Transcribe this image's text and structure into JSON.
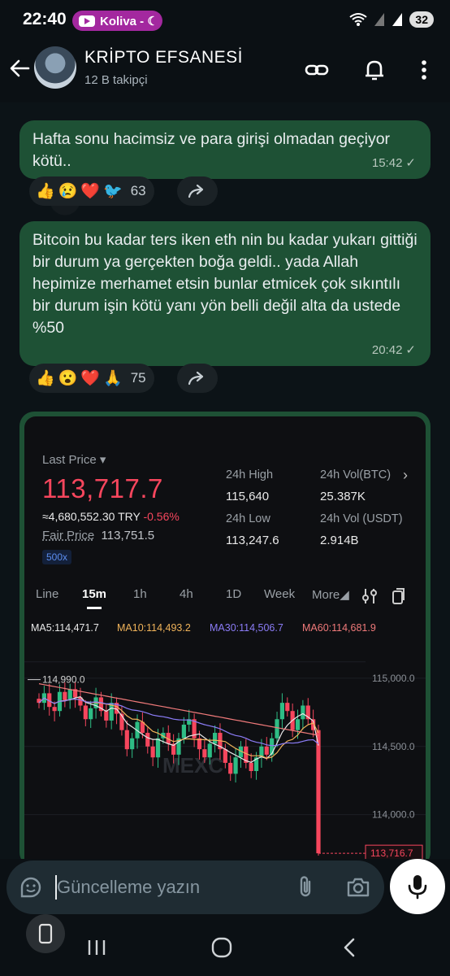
{
  "status_bar": {
    "time": "22:40",
    "media_app": "Koliva - ☾",
    "battery": "32"
  },
  "header": {
    "title": "KRİPTO EFSANESİ",
    "subtitle": "12 B takipçi"
  },
  "messages": [
    {
      "text": "Hafta sonu hacimsiz ve para girişi olmadan geçiyor kötü..",
      "time": "15:42",
      "reactions": [
        "👍",
        "😢",
        "❤️",
        "🐦"
      ],
      "reaction_count": "63"
    },
    {
      "text": "Bitcoin bu kadar ters iken eth nin bu kadar yukarı gittiği bir durum ya gerçekten boğa geldi.. yada Allah hepimize merhamet etsin bunlar etmicek  çok sıkıntılı bir durum işin kötü yanı yön belli değil alta da ustede %50",
      "time": "20:42",
      "reactions": [
        "👍",
        "😮",
        "❤️",
        "🙏"
      ],
      "reaction_count": "75"
    }
  ],
  "trading_screenshot": {
    "last_price_label": "Last Price",
    "last_price": "113,717.7",
    "try_price": "≈4,680,552.30 TRY",
    "change": "-0.56%",
    "fair_price_label": "Fair Price",
    "fair_price": "113,751.5",
    "leverage": "500x",
    "stats": [
      {
        "label": "24h High",
        "value": "115,640"
      },
      {
        "label": "24h Vol(BTC)",
        "value": "25.387K"
      },
      {
        "label": "24h Low",
        "value": "113,247.6"
      },
      {
        "label": "24h Vol (USDT)",
        "value": "2.914B"
      }
    ],
    "tabs": [
      "Line",
      "15m",
      "1h",
      "4h",
      "1D",
      "Week",
      "More"
    ],
    "active_tab": "15m",
    "ma": [
      {
        "label": "MA5:114,471.7",
        "color": "#e8e8e8"
      },
      {
        "label": "MA10:114,493.2",
        "color": "#f0b35a"
      },
      {
        "label": "MA30:114,506.7",
        "color": "#8b7cf6"
      },
      {
        "label": "MA60:114,681.9",
        "color": "#f07a7a"
      }
    ],
    "watermark": "MEXC"
  },
  "chart_data": {
    "type": "candlestick",
    "y_ticks": [
      "115,000.0",
      "114,500.0",
      "114,000.0"
    ],
    "ylim": [
      113700,
      115250
    ],
    "high_marker": "114,990.0",
    "current_price_tag": "113,716.7",
    "candles_close": [
      114820,
      114890,
      114790,
      114760,
      114900,
      114840,
      114920,
      114860,
      114800,
      114700,
      114780,
      114860,
      114760,
      114690,
      114820,
      114740,
      114620,
      114480,
      114560,
      114680,
      114600,
      114500,
      114420,
      114560,
      114600,
      114520,
      114440,
      114560,
      114660,
      114700,
      114560,
      114480,
      114420,
      114520,
      114600,
      114480,
      114380,
      114300,
      114420,
      114500,
      114380,
      114320,
      114420,
      114500,
      114440,
      114560,
      114700,
      114820,
      114760,
      114620,
      114700,
      114800,
      114700,
      114620,
      113717
    ]
  },
  "input": {
    "placeholder": "Güncelleme yazın"
  }
}
